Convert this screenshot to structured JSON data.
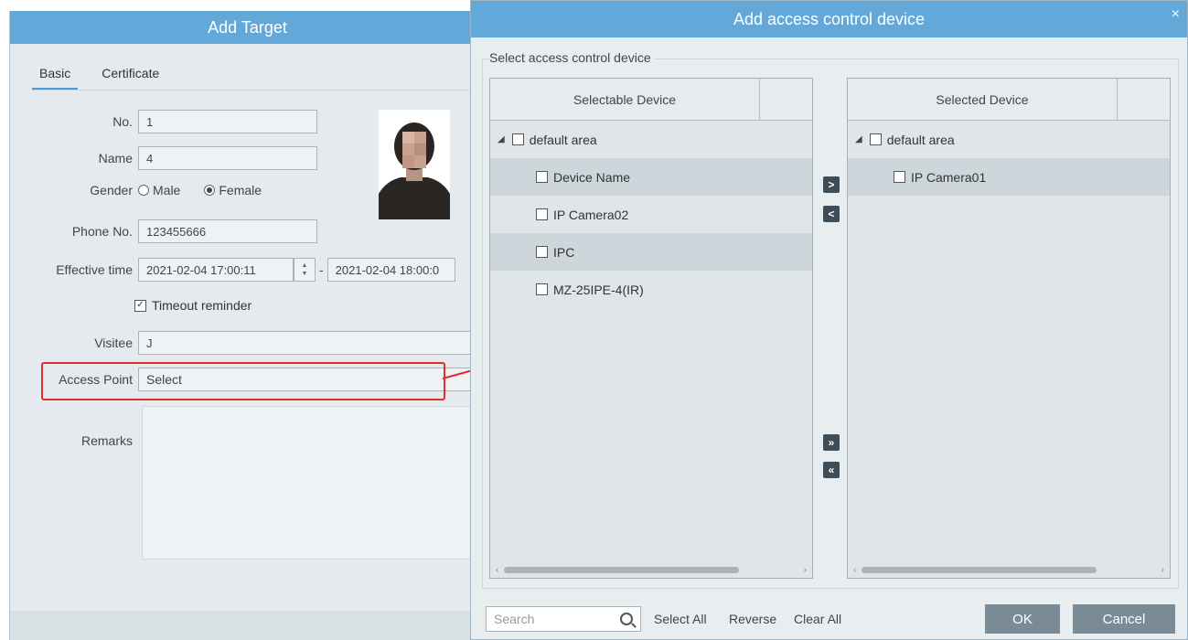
{
  "target_dialog": {
    "title": "Add Target",
    "tabs": [
      "Basic",
      "Certificate"
    ],
    "fields": {
      "no_label": "No.",
      "no_value": "1",
      "name_label": "Name",
      "name_value": "4",
      "gender_label": "Gender",
      "gender_male": "Male",
      "gender_female": "Female",
      "gender_selected": "Female",
      "phone_label": "Phone No.",
      "phone_value": "123455666",
      "effective_label": "Effective time",
      "effective_start": "2021-02-04 17:00:11",
      "effective_sep": "-",
      "effective_end": "2021-02-04 18:00:0",
      "timeout_label": "Timeout reminder",
      "timeout_checked": true,
      "visitee_label": "Visitee",
      "visitee_value": "J",
      "access_label": "Access Point",
      "access_value": "Select",
      "remarks_label": "Remarks"
    }
  },
  "acd_dialog": {
    "title": "Add access control device",
    "close_glyph": "×",
    "group_label": "Select access control device",
    "selectable": {
      "header": "Selectable Device",
      "root": "default area",
      "items": [
        "Device Name",
        "IP Camera02",
        "IPC",
        "MZ-25IPE-4(IR)"
      ]
    },
    "selected": {
      "header": "Selected Device",
      "root": "default area",
      "items": [
        "IP Camera01"
      ]
    },
    "move_buttons": {
      "right": ">",
      "left": "<",
      "all_right": "»",
      "all_left": "«"
    },
    "search_placeholder": "Search",
    "select_all": "Select All",
    "reverse": "Reverse",
    "clear_all": "Clear All",
    "ok": "OK",
    "cancel": "Cancel"
  },
  "colors": {
    "title_bar": "#62a8d8",
    "highlight": "#e52b2b",
    "button": "#7a8b97"
  },
  "icons": [
    "close-icon",
    "search-icon",
    "checkbox-icon",
    "radio-icon",
    "caret-down-icon",
    "spin-icon"
  ]
}
